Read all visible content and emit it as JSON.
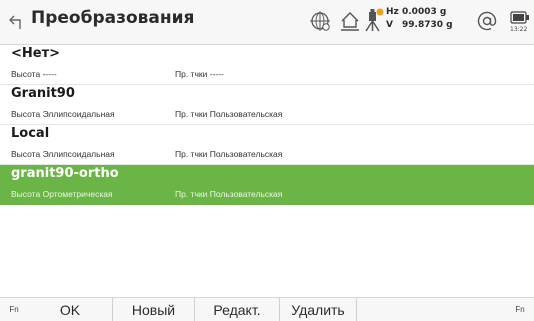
{
  "header": {
    "title": "Преобразования",
    "hz_label": "Hz",
    "hz_value": "0.0003 g",
    "v_label": "V",
    "v_value": "99.8730 g",
    "time": "13:22",
    "icons": [
      "back-icon",
      "crosshair-globe-icon",
      "home-icon",
      "instrument-icon",
      "at-icon",
      "battery-icon"
    ]
  },
  "list": {
    "items": [
      {
        "name": "<Нет>",
        "height_label": "Высота",
        "height_value": "-----",
        "points_label": "Пр. тчки",
        "points_value": "-----",
        "selected": false
      },
      {
        "name": "Granit90",
        "height_label": "Высота",
        "height_value": "Эллипсоидальная",
        "points_label": "Пр. тчки",
        "points_value": "Пользовательская",
        "selected": false
      },
      {
        "name": "Local",
        "height_label": "Высота",
        "height_value": "Эллипсоидальная",
        "points_label": "Пр. тчки",
        "points_value": "Пользовательская",
        "selected": false
      },
      {
        "name": "granit90-ortho",
        "height_label": "Высота",
        "height_value": "Ортометрическая",
        "points_label": "Пр. тчки",
        "points_value": "Пользовательская",
        "selected": true
      }
    ]
  },
  "footer": {
    "fn_left": "Fn",
    "fn_right": "Fn",
    "ok": "OK",
    "new": "Новый",
    "edit": "Редакт.",
    "delete": "Удалить"
  },
  "colors": {
    "selection": "#6ab545",
    "warning_badge": "#f0a020"
  }
}
